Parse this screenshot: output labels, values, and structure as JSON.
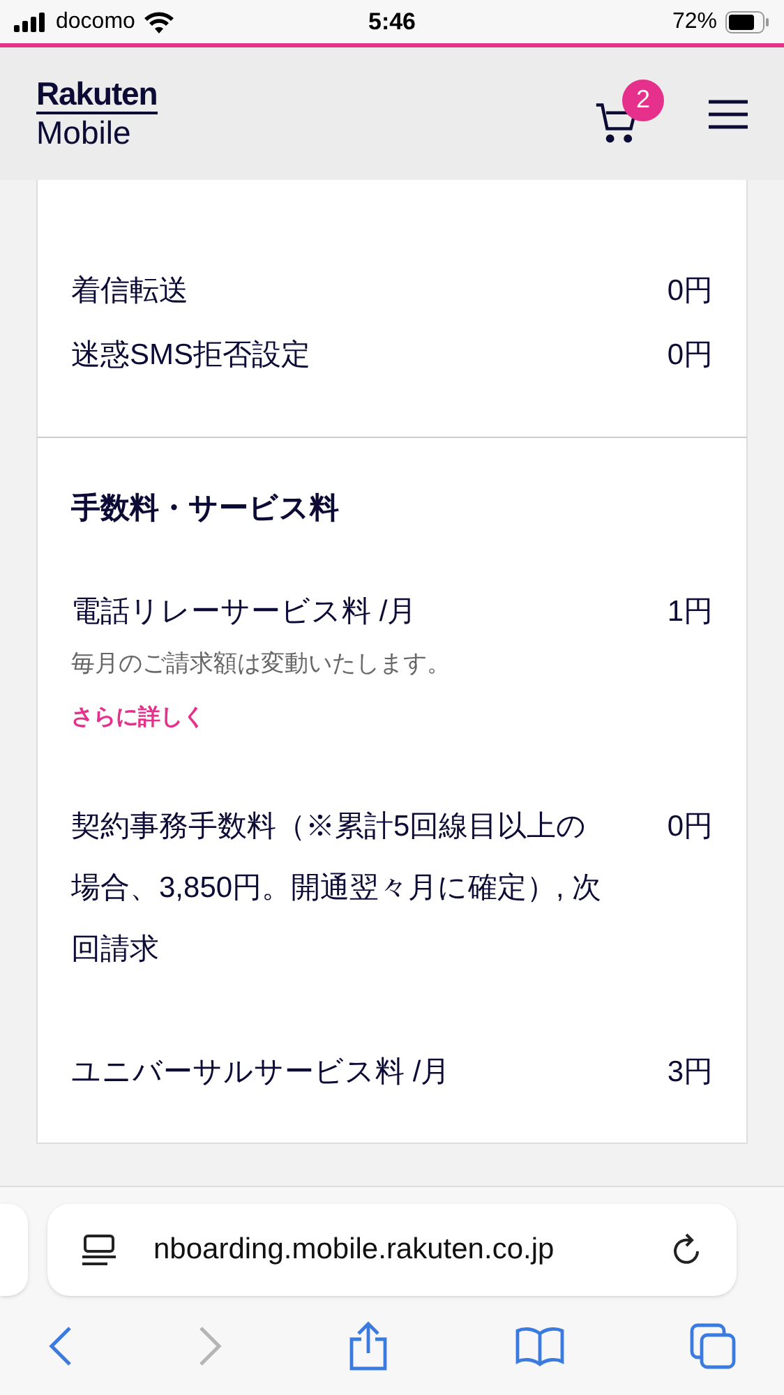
{
  "status_bar": {
    "carrier": "docomo",
    "time": "5:46",
    "battery": "72%"
  },
  "header": {
    "logo_top": "Rakuten",
    "logo_bottom": "Mobile",
    "cart_count": "2"
  },
  "sections": [
    {
      "items": [
        {
          "label": "着信転送",
          "price": "0円"
        },
        {
          "label": "迷惑SMS拒否設定",
          "price": "0円"
        }
      ]
    },
    {
      "heading": "手数料・サービス料",
      "items": [
        {
          "label": "電話リレーサービス料 /月",
          "price": "1円",
          "note": "毎月のご請求額は変動いたします。",
          "link": "さらに詳しく"
        },
        {
          "label": "契約事務手数料（※累計5回線目以上の場合、3,850円。開通翌々月に確定）, 次回請求",
          "price": "0円"
        },
        {
          "label": "ユニバーサルサービス料 /月",
          "price": "3円"
        }
      ]
    }
  ],
  "browser": {
    "url": "nboarding.mobile.rakuten.co.jp"
  }
}
